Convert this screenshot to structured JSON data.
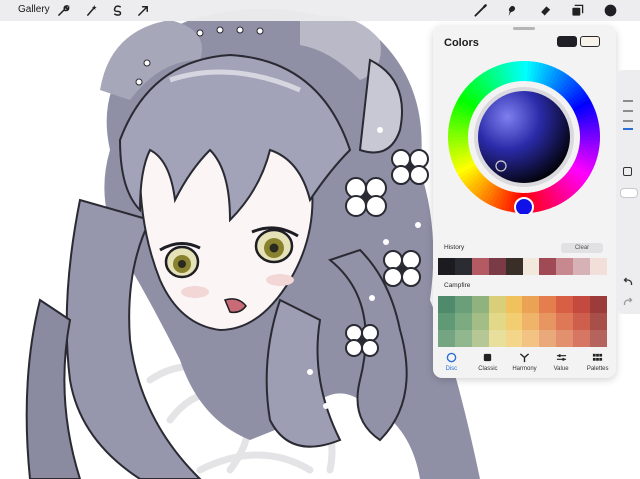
{
  "topbar": {
    "gallery_label": "Gallery",
    "left_tools": [
      "wrench-icon",
      "magic-wand-icon",
      "selection-icon",
      "transform-icon"
    ],
    "right_tools": [
      "brush-icon",
      "smudge-icon",
      "eraser-icon",
      "layers-icon",
      "color-dot"
    ],
    "current_color": "#1f1f25"
  },
  "colors_panel": {
    "title": "Colors",
    "primary_color": "#1f1f25",
    "secondary_color": "#f7f2ea",
    "history_label": "History",
    "clear_label": "Clear",
    "history": [
      "#1c1c20",
      "#2b2b32",
      "#b35a63",
      "#7a3a46",
      "#3a2e28",
      "#f2e8dc",
      "#a04a55",
      "#c78890",
      "#d6b2b6",
      "#f2dfd9"
    ],
    "palette_label": "Campfire",
    "palette": [
      "#4f8a6d",
      "#6a9f7a",
      "#8fb27e",
      "#d9cf7a",
      "#f0c15d",
      "#eaa254",
      "#e47e4d",
      "#d95f44",
      "#c44a3f",
      "#9b3b3a",
      "#5f9976",
      "#7cab82",
      "#a3bd86",
      "#e2d887",
      "#f3cd72",
      "#efb46a",
      "#e79661",
      "#de7856",
      "#cf5f4d",
      "#a84f4a",
      "#74a482",
      "#91b78f",
      "#b4c794",
      "#e9df9c",
      "#f4d68b",
      "#f2c383",
      "#eaa97a",
      "#e2906d",
      "#d67663",
      "#b5645d"
    ],
    "tabs": [
      {
        "icon": "disc-icon",
        "label": "Disc"
      },
      {
        "icon": "classic-square-icon",
        "label": "Classic"
      },
      {
        "icon": "harmony-icon",
        "label": "Harmony"
      },
      {
        "icon": "value-sliders-icon",
        "label": "Value"
      },
      {
        "icon": "palettes-grid-icon",
        "label": "Palettes"
      }
    ]
  },
  "sidebar": {
    "controls": [
      "brush-size-slider",
      "modify-button",
      "opacity-slider",
      "undo-icon",
      "redo-icon"
    ]
  }
}
